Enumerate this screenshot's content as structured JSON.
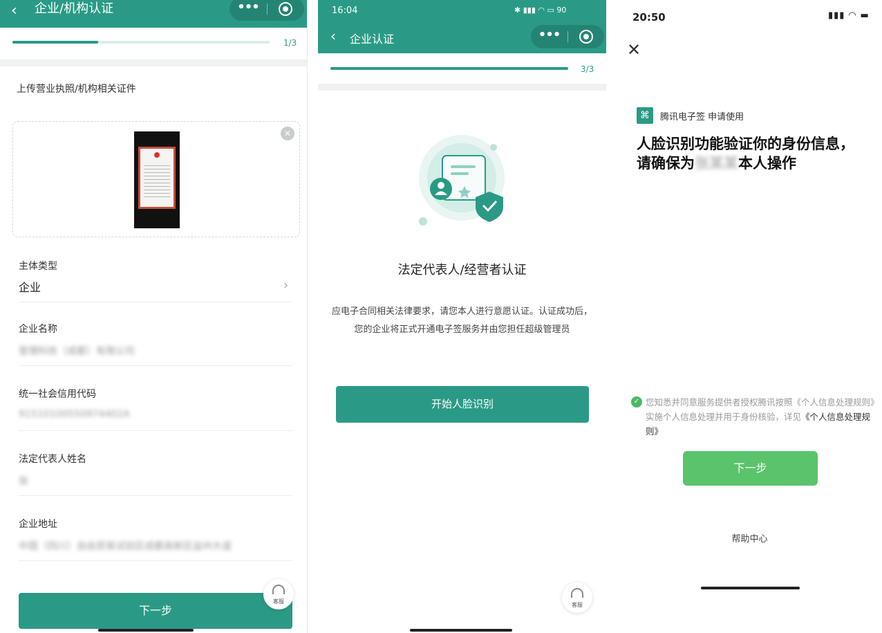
{
  "screen1": {
    "header": {
      "back_icon": "chevron-left-icon",
      "title": "企业/机构认证",
      "menu_icon": "more-dots-icon",
      "capsule_icon": "target-icon"
    },
    "progress": {
      "text": "1/3",
      "fraction": 0.333
    },
    "upload": {
      "title": "上传营业执照/机构相关证件",
      "remove_icon": "close-circle-icon"
    },
    "fields": {
      "entity_type": {
        "label": "主体类型",
        "value": "企业"
      },
      "company_name": {
        "label": "企业名称",
        "value": "管理科技（成都）有限公司"
      },
      "credit_code": {
        "label": "统一社会信用代码",
        "value": "91510100550974402A"
      },
      "legal_rep": {
        "label": "法定代表人姓名",
        "value": "张"
      },
      "address": {
        "label": "企业地址",
        "value": "中国（四川）自由贸易试验区成都高新区益州大道"
      }
    },
    "next_button": "下一步",
    "kefu_label": "客服"
  },
  "screen2": {
    "status": {
      "time": "16:04",
      "icons": "✱ ▮▮▮ ◠ ▭ 90"
    },
    "header": {
      "back_icon": "chevron-left-icon",
      "title": "企业认证"
    },
    "progress": {
      "text": "3/3",
      "fraction": 1.0
    },
    "heading": "法定代表人/经营者认证",
    "desc": "应电子合同相关法律要求，请您本人进行意愿认证。认证成功后，您的企业将正式开通电子签服务并由您担任超级管理员",
    "button": "开始人脸识别",
    "kefu_label": "客服"
  },
  "screen3": {
    "status": {
      "time": "20:50",
      "icons": "▮▮▮ ◠ ▬"
    },
    "close_icon": "close-icon",
    "app_name": "腾讯电子签 申请使用",
    "heading_part1": "人脸识别功能验证你的身份信息，请确保为",
    "heading_masked": "张某某",
    "heading_part2": "本人操作",
    "consent_text": "您知悉并同意服务提供者授权腾讯按照《个人信息处理规则》实施个人信息处理并用于身份核验，详见",
    "consent_link": "《个人信息处理规则》",
    "next_button": "下一步",
    "help": "帮助中心"
  },
  "colors": {
    "primary": "#2a9a86",
    "green_button": "#5bc36c",
    "band": "#f0f2f2"
  }
}
